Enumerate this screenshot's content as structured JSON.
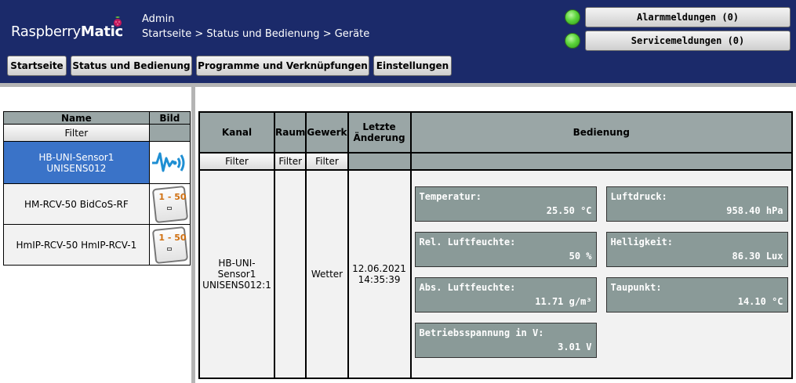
{
  "header": {
    "logo_text_a": "Raspberry",
    "logo_text_b": "Matic",
    "user": "Admin",
    "breadcrumb": "Startseite > Status und Bedienung > Geräte"
  },
  "nav": {
    "home": "Startseite",
    "status": "Status und Bedienung",
    "programs": "Programme und Verknüpfungen",
    "settings": "Einstellungen"
  },
  "messages": {
    "alarm": "Alarmmeldungen (0)",
    "service": "Servicemeldungen (0)",
    "led_color": "#5bd43a"
  },
  "device_list": {
    "col_name": "Name",
    "col_image": "Bild",
    "filter": "Filter",
    "rows": [
      {
        "name_line1": "HB-UNI-Sensor1",
        "name_line2": "UNISENS012",
        "icon": "sensor-wave-icon",
        "selected": true
      },
      {
        "name_line1": "HM-RCV-50 BidCoS-RF",
        "name_line2": "",
        "icon": "remote-control-icon",
        "badge": "1 - 50"
      },
      {
        "name_line1": "HmIP-RCV-50 HmIP-RCV-1",
        "name_line2": "",
        "icon": "remote-control-icon",
        "badge": "1 - 50"
      }
    ],
    "selected_color": "#3a73c8"
  },
  "channel_table": {
    "col_channel": "Kanal",
    "col_room": "Raum",
    "col_trade": "Gewerk",
    "col_last_change_1": "Letzte",
    "col_last_change_2": "Änderung",
    "col_control": "Bedienung",
    "filter": "Filter",
    "row": {
      "channel_1": "HB-UNI-",
      "channel_2": "Sensor1",
      "channel_3": "UNISENS012:1",
      "room": "",
      "trade": "Wetter",
      "date": "12.06.2021",
      "time": "14:35:39"
    },
    "controls": [
      {
        "label": "Temperatur:",
        "value": "25.50 °C"
      },
      {
        "label": "Luftdruck:",
        "value": "958.40 hPa"
      },
      {
        "label": "Rel. Luftfeuchte:",
        "value": "50 %"
      },
      {
        "label": "Helligkeit:",
        "value": "86.30 Lux"
      },
      {
        "label": "Abs. Luftfeuchte:",
        "value": "11.71 g/m³"
      },
      {
        "label": "Taupunkt:",
        "value": "14.10 °C"
      },
      {
        "label": "Betriebsspannung in V:",
        "value": "3.01 V"
      }
    ]
  }
}
